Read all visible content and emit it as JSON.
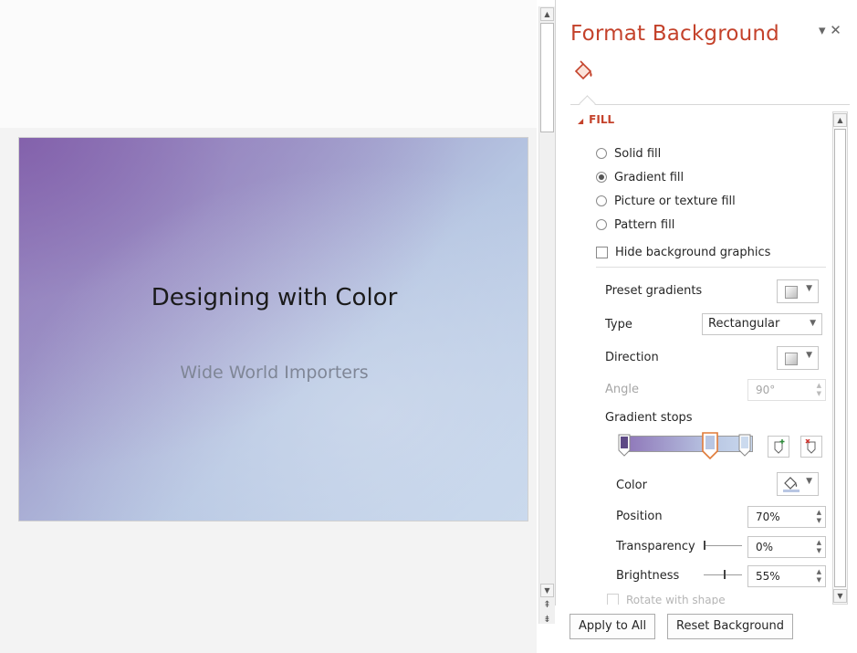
{
  "slide": {
    "title": "Designing with Color",
    "subtitle": "Wide World Importers"
  },
  "pane": {
    "title": "Format Background",
    "controls": "▾ ✕",
    "fill_section": "FILL",
    "fill_options": [
      {
        "label": "Solid fill",
        "selected": false
      },
      {
        "label": "Gradient fill",
        "selected": true
      },
      {
        "label": "Picture or texture fill",
        "selected": false
      },
      {
        "label": "Pattern fill",
        "selected": false
      }
    ],
    "hide_background_graphics": {
      "label": "Hide background graphics",
      "checked": false
    },
    "preset_gradients_label": "Preset gradients",
    "type_label": "Type",
    "type_value": "Rectangular",
    "direction_label": "Direction",
    "angle_label": "Angle",
    "angle_value": "90°",
    "gradient_stops_label": "Gradient stops",
    "color_label": "Color",
    "position_label": "Position",
    "position_value": "70%",
    "transparency_label": "Transparency",
    "transparency_value": "0%",
    "transparency_level": 0,
    "brightness_label": "Brightness",
    "brightness_value": "55%",
    "brightness_level": 0.55,
    "rotate_label": "Rotate with shape",
    "apply_all": "Apply to All",
    "reset": "Reset Background"
  },
  "colors": {
    "accent": "#c4422b",
    "stop_selected": "#e07b39"
  }
}
